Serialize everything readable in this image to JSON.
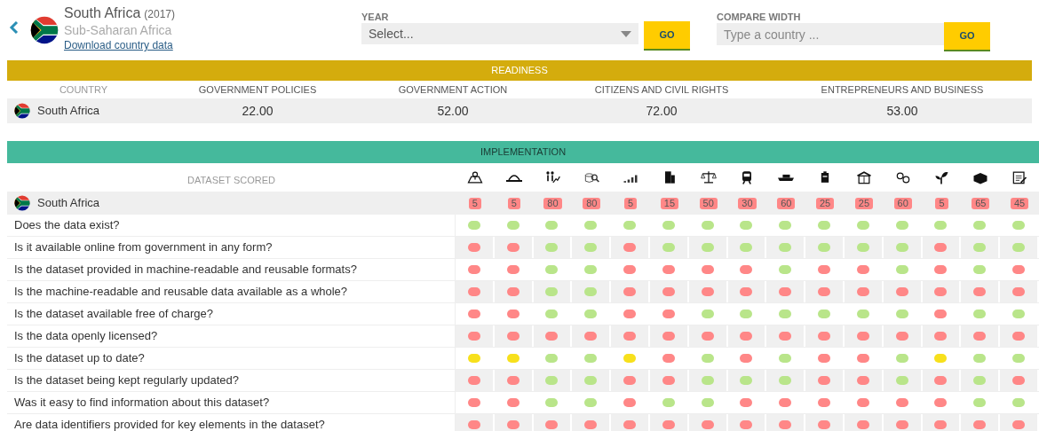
{
  "header": {
    "country": "South Africa",
    "year": "(2017)",
    "region": "Sub-Saharan Africa",
    "download_link": "Download country data"
  },
  "year_filter": {
    "label": "YEAR",
    "value": "Select...",
    "button": "GO"
  },
  "compare": {
    "label": "COMPARE WIDTH",
    "placeholder": "Type a country ...",
    "button": "GO"
  },
  "readiness": {
    "title": "READINESS",
    "columns": [
      "COUNTRY",
      "GOVERNMENT POLICIES",
      "GOVERNMENT ACTION",
      "CITIZENS AND CIVIL RIGHTS",
      "ENTREPRENEURS AND BUSINESS"
    ],
    "row": {
      "country": "South Africa",
      "values": [
        "22.00",
        "52.00",
        "72.00",
        "53.00"
      ]
    }
  },
  "implementation": {
    "title": "IMPLEMENTATION",
    "first_column": "DATASET SCORED",
    "country": "South Africa",
    "scores": [
      "5",
      "5",
      "80",
      "80",
      "5",
      "15",
      "50",
      "30",
      "60",
      "25",
      "25",
      "60",
      "5",
      "65",
      "45"
    ],
    "rows": [
      {
        "question": "Does the data exist?",
        "dots": [
          {
            "color": "#b9e58a"
          },
          {
            "color": "#b9e58a"
          },
          {
            "color": "#b9e58a"
          },
          {
            "color": "#b9e58a"
          },
          {
            "color": "#b9e58a"
          },
          {
            "color": "#b9e58a"
          },
          {
            "color": "#b9e58a"
          },
          {
            "color": "#b9e58a"
          },
          {
            "color": "#b9e58a"
          },
          {
            "color": "#b9e58a"
          },
          {
            "color": "#b9e58a"
          },
          {
            "color": "#b9e58a"
          },
          {
            "color": "#b9e58a"
          },
          {
            "color": "#b9e58a"
          },
          {
            "color": "#b9e58a"
          }
        ]
      },
      {
        "question": "Is it available online from government in any form?",
        "dots": [
          {
            "color": "#ff8787"
          },
          {
            "color": "#ff8787"
          },
          {
            "color": "#b9e58a"
          },
          {
            "color": "#b9e58a"
          },
          {
            "color": "#ff8787"
          },
          {
            "color": "#b9e58a"
          },
          {
            "color": "#b9e58a"
          },
          {
            "color": "#b9e58a"
          },
          {
            "color": "#b9e58a"
          },
          {
            "color": "#b9e58a"
          },
          {
            "color": "#b9e58a"
          },
          {
            "color": "#b9e58a"
          },
          {
            "color": "#ff8787"
          },
          {
            "color": "#b9e58a"
          },
          {
            "color": "#b9e58a"
          }
        ]
      },
      {
        "question": "Is the dataset provided in machine-readable and reusable formats?",
        "dots": [
          {
            "color": "#ff8787"
          },
          {
            "color": "#ff8787"
          },
          {
            "color": "#b9e58a"
          },
          {
            "color": "#b9e58a"
          },
          {
            "color": "#ff8787"
          },
          {
            "color": "#ff8787"
          },
          {
            "color": "#ff8787"
          },
          {
            "color": "#ff8787"
          },
          {
            "color": "#b9e58a"
          },
          {
            "color": "#ff8787"
          },
          {
            "color": "#ff8787"
          },
          {
            "color": "#b9e58a"
          },
          {
            "color": "#ff8787"
          },
          {
            "color": "#b9e58a"
          },
          {
            "color": "#ff8787"
          }
        ]
      },
      {
        "question": "Is the machine-readable and reusable data available as a whole?",
        "dots": [
          {
            "color": "#ff8787"
          },
          {
            "color": "#ff8787"
          },
          {
            "color": "#b9e58a"
          },
          {
            "color": "#b9e58a"
          },
          {
            "color": "#ff8787"
          },
          {
            "color": "#ff8787"
          },
          {
            "color": "#ff8787"
          },
          {
            "color": "#ff8787"
          },
          {
            "color": "#ff8787"
          },
          {
            "color": "#ff8787"
          },
          {
            "color": "#ff8787"
          },
          {
            "color": "#ff8787"
          },
          {
            "color": "#ff8787"
          },
          {
            "color": "#ff8787"
          },
          {
            "color": "#ff8787"
          }
        ]
      },
      {
        "question": "Is the dataset available free of charge?",
        "dots": [
          {
            "color": "#ff8787"
          },
          {
            "color": "#ff8787"
          },
          {
            "color": "#b9e58a"
          },
          {
            "color": "#b9e58a"
          },
          {
            "color": "#ff8787"
          },
          {
            "color": "#ff8787"
          },
          {
            "color": "#b9e58a"
          },
          {
            "color": "#b9e58a"
          },
          {
            "color": "#b9e58a"
          },
          {
            "color": "#b9e58a"
          },
          {
            "color": "#b9e58a"
          },
          {
            "color": "#b9e58a"
          },
          {
            "color": "#ff8787"
          },
          {
            "color": "#b9e58a"
          },
          {
            "color": "#b9e58a"
          }
        ]
      },
      {
        "question": "Is the data openly licensed?",
        "dots": [
          {
            "color": "#ff8787"
          },
          {
            "color": "#ff8787"
          },
          {
            "color": "#ff8787"
          },
          {
            "color": "#ff8787"
          },
          {
            "color": "#ff8787"
          },
          {
            "color": "#ff8787"
          },
          {
            "color": "#ff8787"
          },
          {
            "color": "#ff8787"
          },
          {
            "color": "#ff8787"
          },
          {
            "color": "#ff8787"
          },
          {
            "color": "#ff8787"
          },
          {
            "color": "#ff8787"
          },
          {
            "color": "#ff8787"
          },
          {
            "color": "#ff8787"
          },
          {
            "color": "#ff8787"
          }
        ]
      },
      {
        "question": "Is the dataset up to date?",
        "dots": [
          {
            "color": "#f7e01c"
          },
          {
            "color": "#f7e01c"
          },
          {
            "color": "#b9e58a"
          },
          {
            "color": "#b9e58a"
          },
          {
            "color": "#f7e01c"
          },
          {
            "color": "#ff8787"
          },
          {
            "color": "#b9e58a"
          },
          {
            "color": "#ff8787"
          },
          {
            "color": "#b9e58a"
          },
          {
            "color": "#ff8787"
          },
          {
            "color": "#ff8787"
          },
          {
            "color": "#b9e58a"
          },
          {
            "color": "#f7e01c"
          },
          {
            "color": "#b9e58a"
          },
          {
            "color": "#b9e58a"
          }
        ]
      },
      {
        "question": "Is the dataset being kept regularly updated?",
        "dots": [
          {
            "color": "#ff8787"
          },
          {
            "color": "#ff8787"
          },
          {
            "color": "#b9e58a"
          },
          {
            "color": "#b9e58a"
          },
          {
            "color": "#ff8787"
          },
          {
            "color": "#ff8787"
          },
          {
            "color": "#b9e58a"
          },
          {
            "color": "#b9e58a"
          },
          {
            "color": "#b9e58a"
          },
          {
            "color": "#ff8787"
          },
          {
            "color": "#ff8787"
          },
          {
            "color": "#b9e58a"
          },
          {
            "color": "#ff8787"
          },
          {
            "color": "#b9e58a"
          },
          {
            "color": "#ff8787"
          }
        ]
      },
      {
        "question": "Was it easy to find information about this dataset?",
        "dots": [
          {
            "color": "#ff8787"
          },
          {
            "color": "#ff8787"
          },
          {
            "color": "#b9e58a"
          },
          {
            "color": "#b9e58a"
          },
          {
            "color": "#ff8787"
          },
          {
            "color": "#b9e58a"
          },
          {
            "color": "#b9e58a"
          },
          {
            "color": "#ff8787"
          },
          {
            "color": "#ff8787"
          },
          {
            "color": "#ff8787"
          },
          {
            "color": "#ff8787"
          },
          {
            "color": "#ff8787"
          },
          {
            "color": "#ff8787"
          },
          {
            "color": "#b9e58a"
          },
          {
            "color": "#b9e58a"
          }
        ]
      },
      {
        "question": "Are data identifiers provided for key elements in the dataset?",
        "dots": [
          {
            "color": "#ff8787"
          },
          {
            "color": "#ff8787"
          },
          {
            "color": "#ff8787"
          },
          {
            "color": "#ff8787"
          },
          {
            "color": "#ff8787"
          },
          {
            "color": "#ff8787"
          },
          {
            "color": "#ff8787"
          },
          {
            "color": "#ff8787"
          },
          {
            "color": "#ff8787"
          },
          {
            "color": "#ff8787"
          },
          {
            "color": "#ff8787"
          },
          {
            "color": "#ff8787"
          },
          {
            "color": "#ff8787"
          },
          {
            "color": "#ff8787"
          },
          {
            "color": "#ff8787"
          }
        ]
      }
    ]
  }
}
